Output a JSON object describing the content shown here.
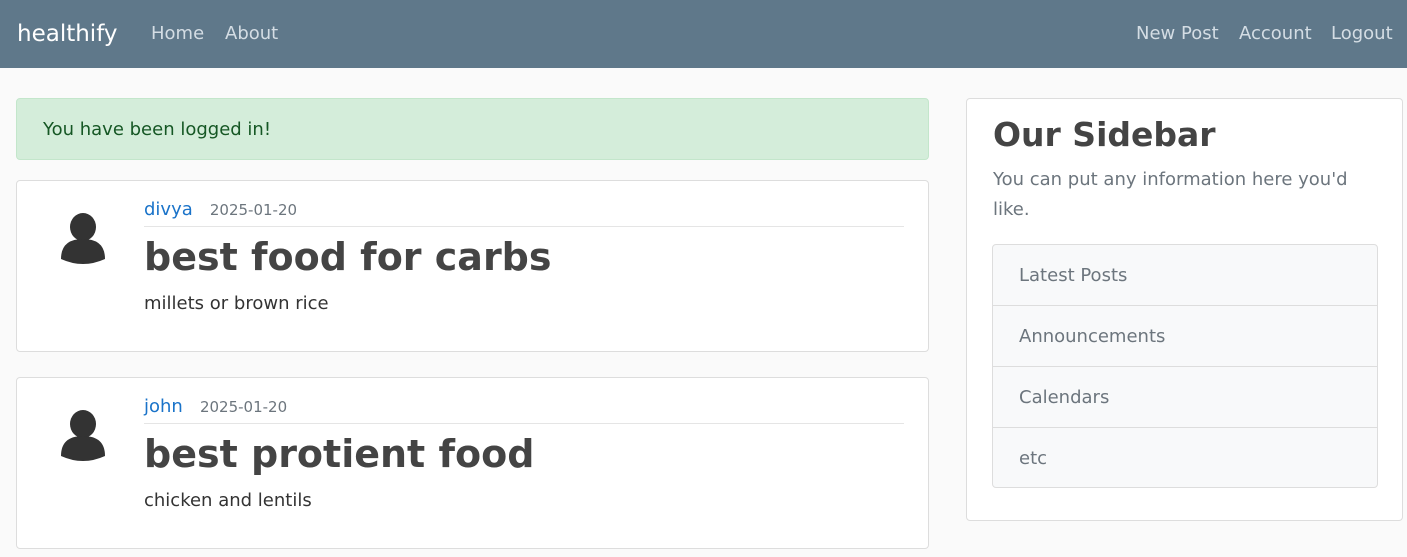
{
  "navbar": {
    "brand": "healthify",
    "left_links": [
      "Home",
      "About"
    ],
    "right_links": [
      "New Post",
      "Account",
      "Logout"
    ]
  },
  "alert": {
    "message": "You have been logged in!"
  },
  "posts": [
    {
      "author": "divya",
      "date": "2025-01-20",
      "title": "best food for carbs",
      "content": "millets or brown rice"
    },
    {
      "author": "john",
      "date": "2025-01-20",
      "title": "best protient food",
      "content": "chicken and lentils"
    }
  ],
  "sidebar": {
    "title": "Our Sidebar",
    "text": "You can put any information here you'd like.",
    "items": [
      "Latest Posts",
      "Announcements",
      "Calendars",
      "etc"
    ]
  },
  "colors": {
    "navbar": "#5f788a",
    "alert_bg": "#d4edda",
    "alert_text": "#155724",
    "link": "#1a73c9"
  },
  "icons": {
    "avatar": "user-silhouette-icon"
  }
}
